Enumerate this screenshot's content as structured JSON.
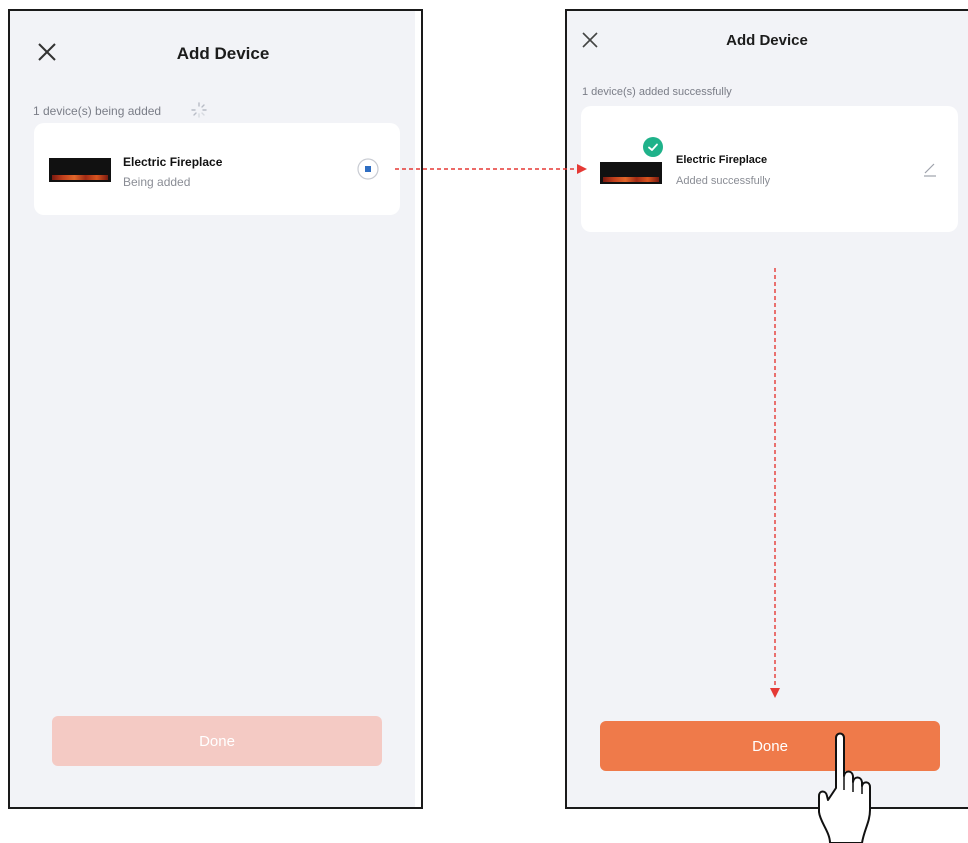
{
  "left_screen": {
    "title": "Add Device",
    "status_text": "1 device(s) being added",
    "device": {
      "name": "Electric Fireplace",
      "status": "Being added"
    },
    "done_label": "Done",
    "done_enabled": false
  },
  "right_screen": {
    "title": "Add Device",
    "status_text": "1 device(s) added successfully",
    "device": {
      "name": "Electric Fireplace",
      "status": "Added successfully"
    },
    "done_label": "Done",
    "done_enabled": true
  },
  "colors": {
    "accent": "#ef7a4a",
    "accent_disabled": "#f4cac4",
    "success": "#1fb28a",
    "annotation_arrow": "#e53935",
    "stop_button": "#2f6ec2"
  },
  "icons": [
    "close-icon",
    "loading-spinner-icon",
    "stop-icon",
    "check-icon",
    "edit-pencil-icon",
    "hand-pointer-icon"
  ]
}
